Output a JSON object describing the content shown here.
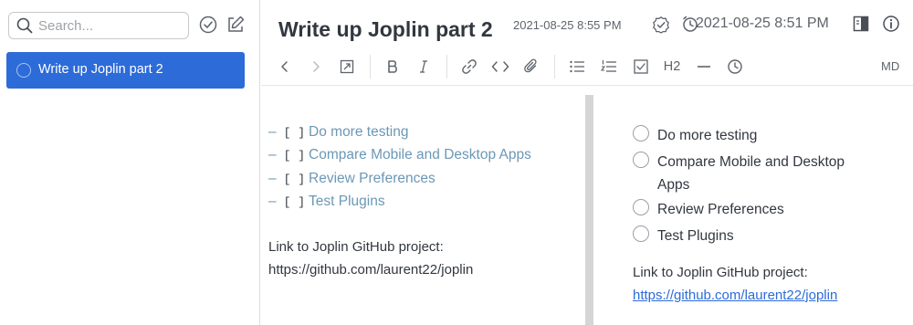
{
  "sidebar": {
    "search": {
      "placeholder": "Search...",
      "value": ""
    },
    "icons": {
      "search": "search-icon",
      "toggle_todos": "checkmark-circle-icon",
      "new_note": "compose-icon"
    },
    "notes": [
      {
        "title": "Write up Joplin part 2",
        "selected": true,
        "is_todo": true
      }
    ],
    "selected_color": "#2d6bd8"
  },
  "header": {
    "title": "Write up Joplin part 2",
    "updated": "2021-08-25 8:55 PM",
    "alarm": "2021-08-25 8:51 PM",
    "icons": [
      "todo-status-icon",
      "alarm-clock-icon",
      "layout-toggle-icon",
      "info-icon"
    ]
  },
  "toolbar": {
    "heading_label": "H2",
    "editor_mode": "MD",
    "buttons": [
      "back-icon",
      "forward-icon",
      "external-edit-icon",
      "bold-icon",
      "italic-icon",
      "link-icon",
      "code-icon",
      "attach-icon",
      "bullet-list-icon",
      "numbered-list-icon",
      "checkbox-list-icon",
      "heading-button",
      "horizontal-rule-icon",
      "insert-time-icon"
    ]
  },
  "editor": {
    "bullet": "–",
    "box": "[ ]",
    "checklist": [
      "Do more testing",
      "Compare Mobile and Desktop Apps",
      "Review Preferences",
      "Test Plugins"
    ],
    "link_label": "Link to Joplin GitHub project:",
    "link_url": "https://github.com/laurent22/joplin"
  },
  "viewer": {
    "checklist": [
      {
        "text": "Do more testing",
        "checked": false
      },
      {
        "text": "Compare Mobile and Desktop Apps",
        "checked": false
      },
      {
        "text": "Review Preferences",
        "checked": false
      },
      {
        "text": "Test Plugins",
        "checked": false
      }
    ],
    "link_label": "Link to Joplin GitHub project:",
    "link_url": "https://github.com/laurent22/joplin",
    "link_color": "#2d6bd8"
  }
}
